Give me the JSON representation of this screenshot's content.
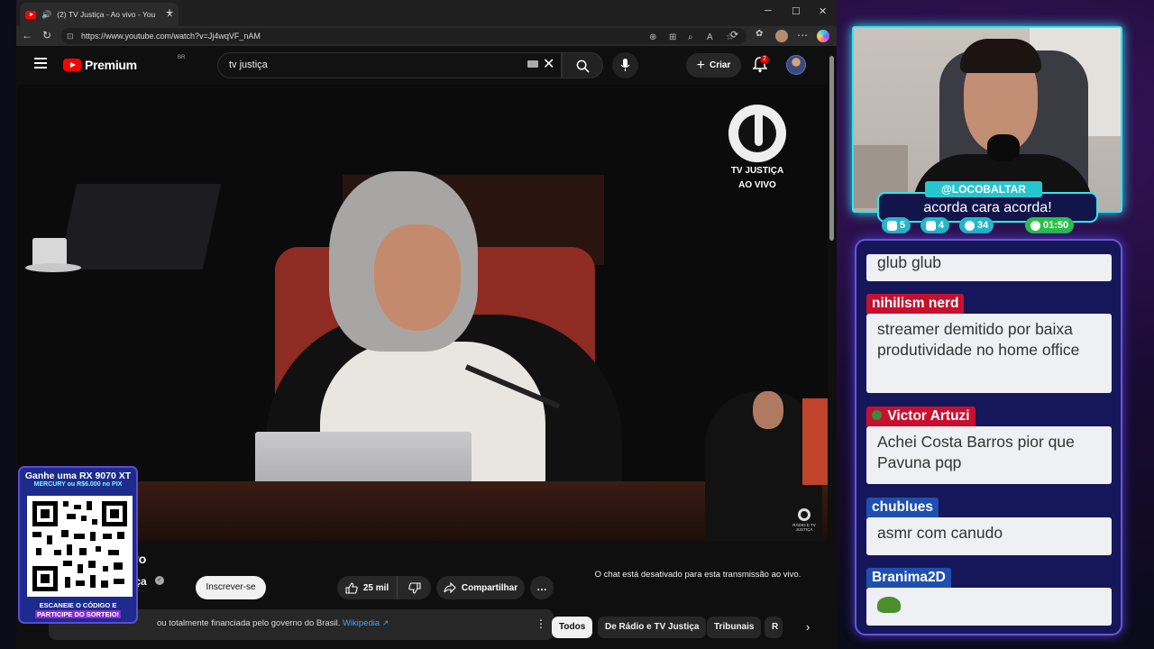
{
  "browser": {
    "tab_title": "(2) TV Justiça - Ao vivo - You",
    "new_tab_label": "+",
    "window_controls": {
      "minimize": "─",
      "maximize": "☐",
      "close": "✕"
    },
    "url": "https://www.youtube.com/watch?v=Jj4wqVF_nAM"
  },
  "youtube": {
    "logo_text": "Premium",
    "logo_region": "BR",
    "search_value": "tv justiça",
    "create_label": "Criar",
    "notifications_count": "2"
  },
  "video": {
    "overlay_logo_line1": "TV JUSTIÇA",
    "overlay_logo_line2": "AO VIVO",
    "corner_logo_text": "RÁDIO E TV JUSTIÇA",
    "title_partial": "vo",
    "channel_partial": "iça",
    "subscribe_label": "Inscrever-se",
    "likes": "25 mil",
    "share_label": "Compartilhar",
    "more_label": "…"
  },
  "chat": {
    "disabled_message": "O chat está desativado para esta transmissão ao vivo."
  },
  "info_banner": {
    "text": "TV Justiça é parcialmente ou totalmente financiada pelo governo do Brasil.",
    "visible_text": "ou totalmente financiada pelo governo do Brasil.",
    "link": "Wikipedia"
  },
  "chips": [
    "Todos",
    "De Rádio e TV Justiça",
    "Tribunais",
    "R"
  ],
  "qr_overlay": {
    "line1": "Ganhe uma RX 9070 XT",
    "line2": "MERCURY ou R$6.000 no PIX",
    "line3": "ESCANEIE O CÓDIGO E",
    "line4": "PARTICIPE DO SORTEIO!"
  },
  "webcam": {
    "username": "@LOCOBALTAR",
    "message": "acorda cara acorda!",
    "stats": {
      "twitch": "5",
      "youtube": "4",
      "kick": "34",
      "timer": "01:50"
    }
  },
  "stream_chat": {
    "messages": [
      {
        "user": "",
        "text": "glub glub",
        "user_color": "#c8102e"
      },
      {
        "user": "nihilism nerd",
        "text": "streamer demitido por baixa produtividade no home office",
        "user_color": "#c8102e"
      },
      {
        "user": "Victor Artuzi",
        "text": "Achei Costa Barros pior que Pavuna pqp",
        "user_color": "#c8102e"
      },
      {
        "user": "chublues",
        "text": "asmr com canudo",
        "user_color": "#1f4fb0"
      },
      {
        "user": "Branima2D",
        "text": "",
        "user_color": "#1f4fb0"
      }
    ]
  },
  "colors": {
    "youtube_red": "#ff0000",
    "accent_cyan": "#2ee6f0",
    "chat_panel": "#15175a",
    "link_blue": "#3ea6ff"
  }
}
